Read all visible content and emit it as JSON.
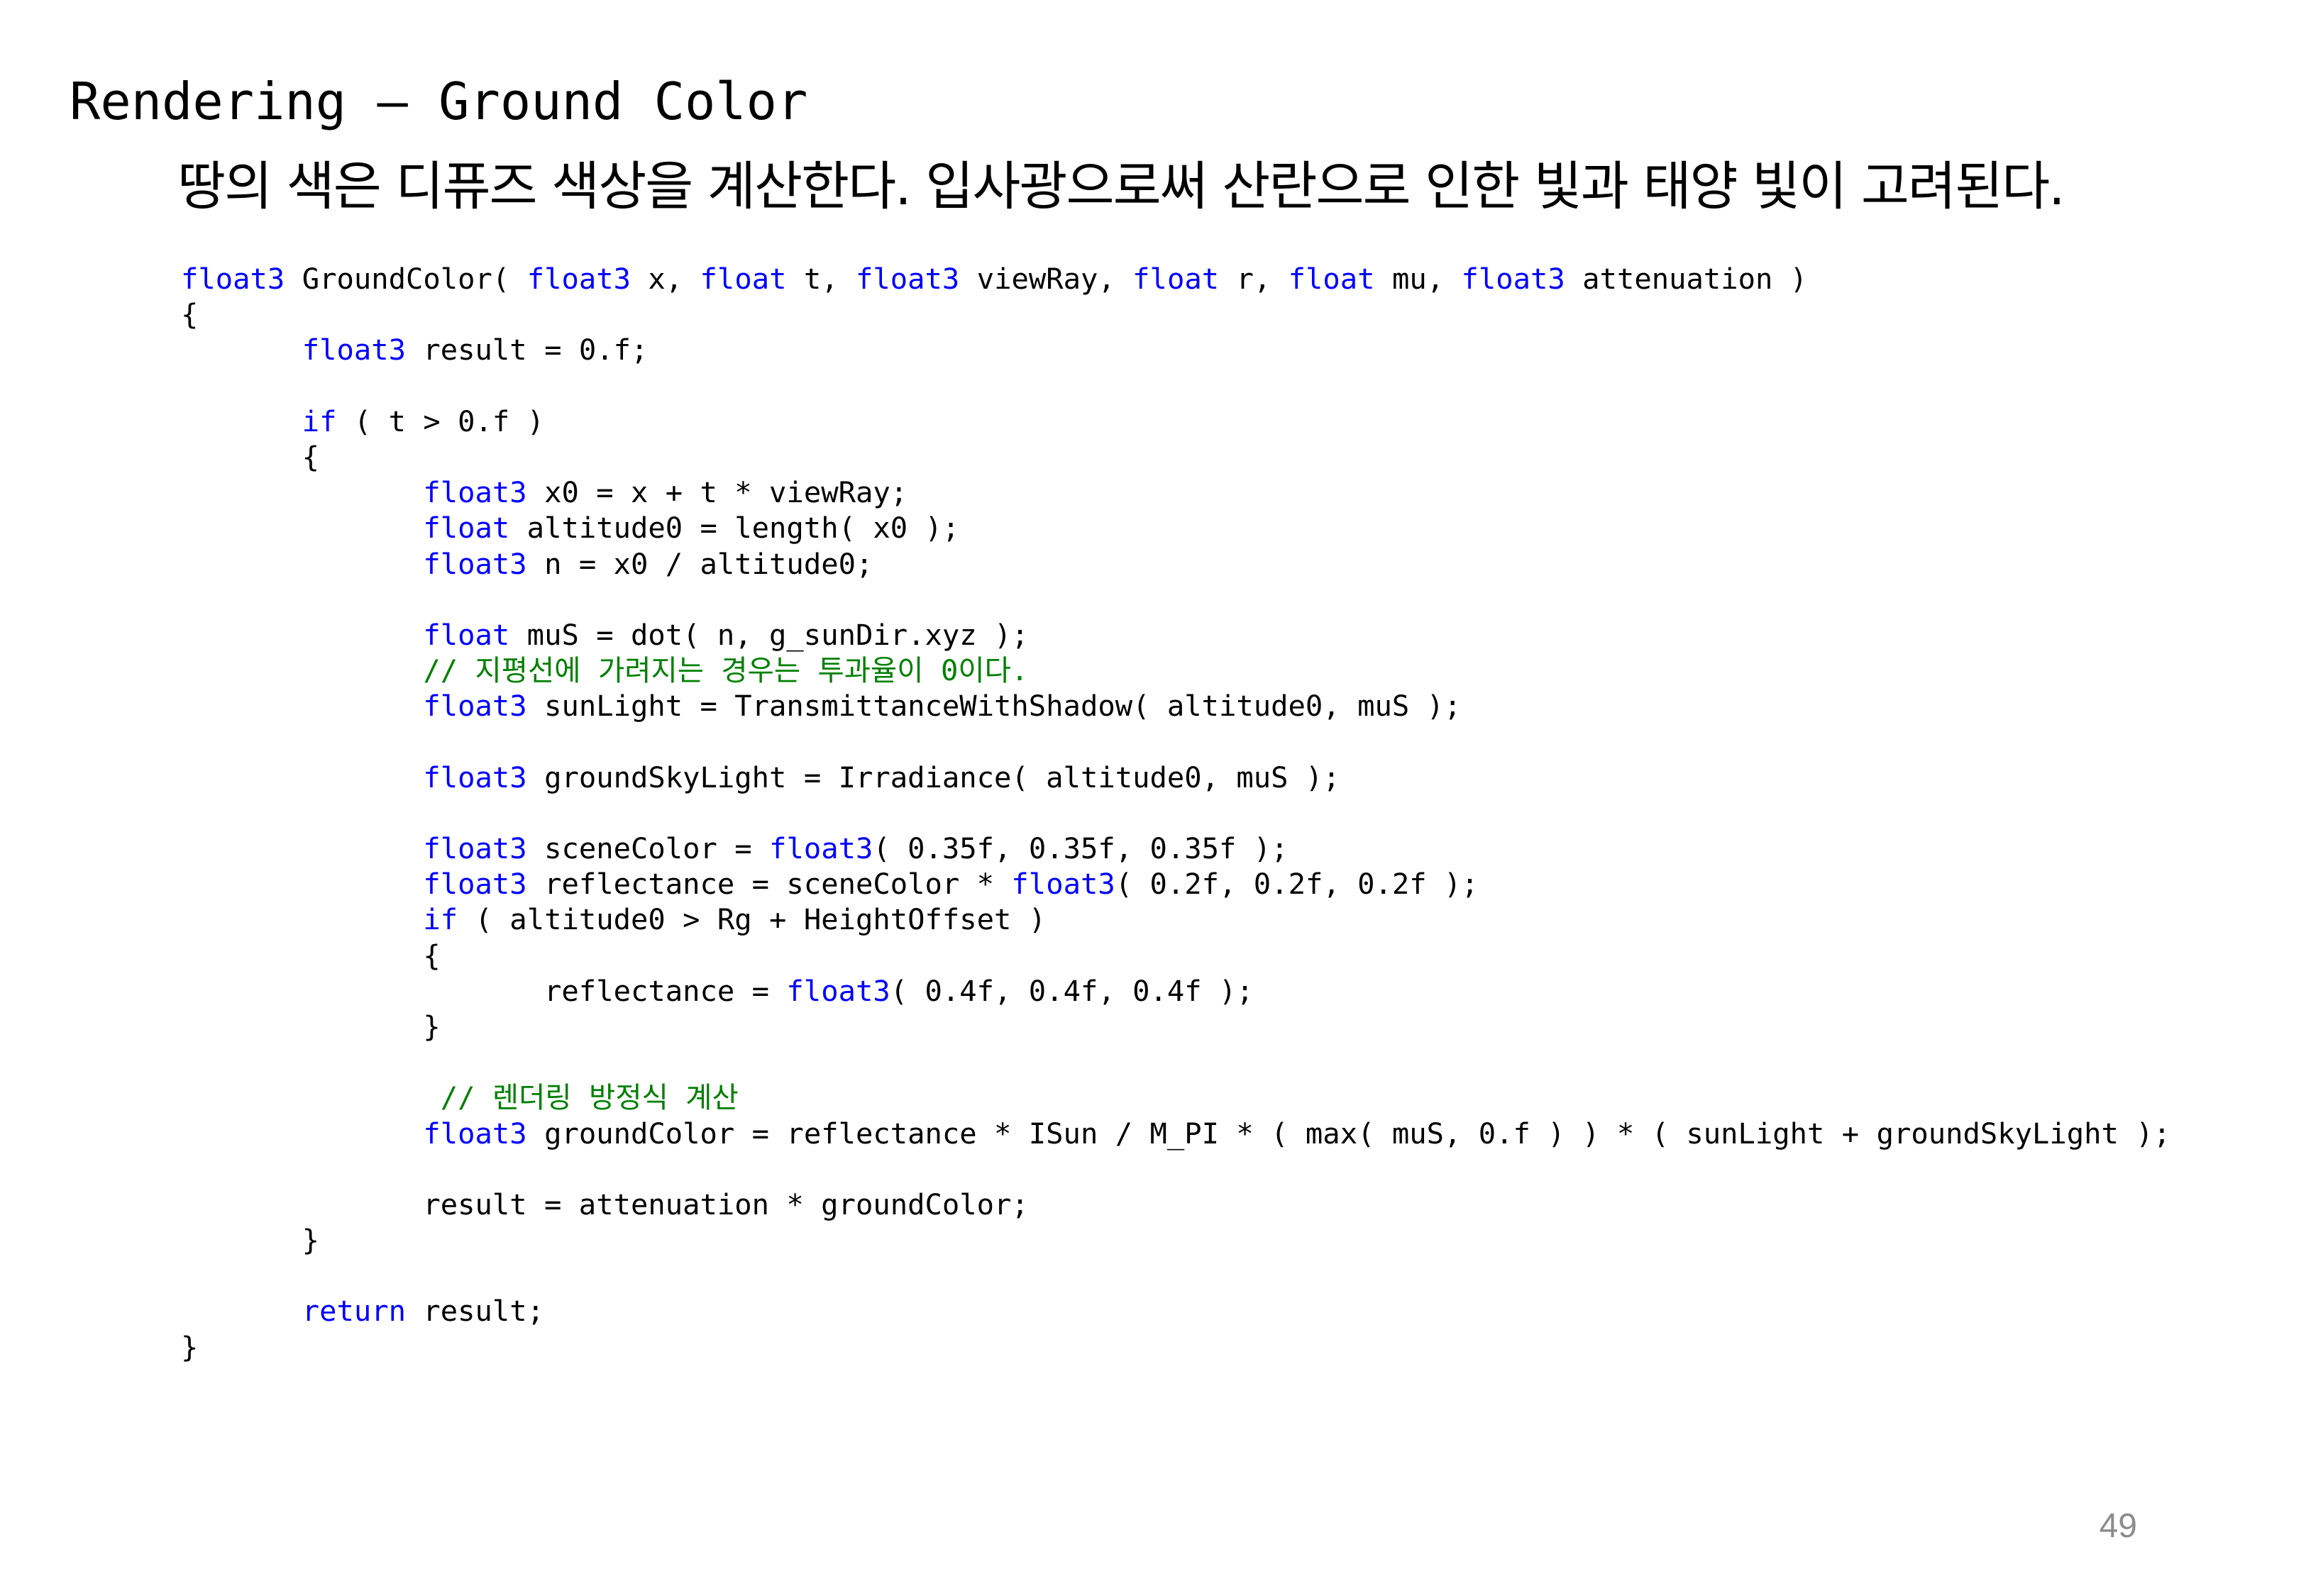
{
  "slide": {
    "title": "Rendering – Ground Color",
    "subtitle": "땅의 색은 디퓨즈 색상을 계산한다. 입사광으로써 산란으로 인한 빛과 태양 빛이 고려된다.",
    "page_number": "49"
  },
  "colors": {
    "keyword": "#0000ff",
    "comment": "#008000",
    "plain": "#000000",
    "page_number": "#8c8c8c"
  },
  "code": {
    "language": "hlsl",
    "lines": [
      [
        {
          "t": "kw",
          "v": "float3"
        },
        {
          "t": "pt",
          "v": " GroundColor( "
        },
        {
          "t": "kw",
          "v": "float3"
        },
        {
          "t": "pt",
          "v": " x, "
        },
        {
          "t": "kw",
          "v": "float"
        },
        {
          "t": "pt",
          "v": " t, "
        },
        {
          "t": "kw",
          "v": "float3"
        },
        {
          "t": "pt",
          "v": " viewRay, "
        },
        {
          "t": "kw",
          "v": "float"
        },
        {
          "t": "pt",
          "v": " r, "
        },
        {
          "t": "kw",
          "v": "float"
        },
        {
          "t": "pt",
          "v": " mu, "
        },
        {
          "t": "kw",
          "v": "float3"
        },
        {
          "t": "pt",
          "v": " attenuation )"
        }
      ],
      [
        {
          "t": "pt",
          "v": "{"
        }
      ],
      [
        {
          "t": "pt",
          "v": "\t"
        },
        {
          "t": "kw",
          "v": "float3"
        },
        {
          "t": "pt",
          "v": " result = 0.f;"
        }
      ],
      [],
      [
        {
          "t": "pt",
          "v": "\t"
        },
        {
          "t": "kw",
          "v": "if"
        },
        {
          "t": "pt",
          "v": " ( t > 0.f )"
        }
      ],
      [
        {
          "t": "pt",
          "v": "\t{"
        }
      ],
      [
        {
          "t": "pt",
          "v": "\t\t"
        },
        {
          "t": "kw",
          "v": "float3"
        },
        {
          "t": "pt",
          "v": " x0 = x + t * viewRay;"
        }
      ],
      [
        {
          "t": "pt",
          "v": "\t\t"
        },
        {
          "t": "kw",
          "v": "float"
        },
        {
          "t": "pt",
          "v": " altitude0 = length( x0 );"
        }
      ],
      [
        {
          "t": "pt",
          "v": "\t\t"
        },
        {
          "t": "kw",
          "v": "float3"
        },
        {
          "t": "pt",
          "v": " n = x0 / altitude0;"
        }
      ],
      [],
      [
        {
          "t": "pt",
          "v": "\t\t"
        },
        {
          "t": "kw",
          "v": "float"
        },
        {
          "t": "pt",
          "v": " muS = dot( n, g_sunDir.xyz );"
        }
      ],
      [
        {
          "t": "pt",
          "v": "\t\t"
        },
        {
          "t": "cm",
          "v": "// 지평선에 가려지는 경우는 투과율이 0이다."
        }
      ],
      [
        {
          "t": "pt",
          "v": "\t\t"
        },
        {
          "t": "kw",
          "v": "float3"
        },
        {
          "t": "pt",
          "v": " sunLight = TransmittanceWithShadow( altitude0, muS );"
        }
      ],
      [],
      [
        {
          "t": "pt",
          "v": "\t\t"
        },
        {
          "t": "kw",
          "v": "float3"
        },
        {
          "t": "pt",
          "v": " groundSkyLight = Irradiance( altitude0, muS );"
        }
      ],
      [],
      [
        {
          "t": "pt",
          "v": "\t\t"
        },
        {
          "t": "kw",
          "v": "float3"
        },
        {
          "t": "pt",
          "v": " sceneColor = "
        },
        {
          "t": "kw",
          "v": "float3"
        },
        {
          "t": "pt",
          "v": "( 0.35f, 0.35f, 0.35f );"
        }
      ],
      [
        {
          "t": "pt",
          "v": "\t\t"
        },
        {
          "t": "kw",
          "v": "float3"
        },
        {
          "t": "pt",
          "v": " reflectance = sceneColor * "
        },
        {
          "t": "kw",
          "v": "float3"
        },
        {
          "t": "pt",
          "v": "( 0.2f, 0.2f, 0.2f );"
        }
      ],
      [
        {
          "t": "pt",
          "v": "\t\t"
        },
        {
          "t": "kw",
          "v": "if"
        },
        {
          "t": "pt",
          "v": " ( altitude0 > Rg + HeightOffset )"
        }
      ],
      [
        {
          "t": "pt",
          "v": "\t\t{"
        }
      ],
      [
        {
          "t": "pt",
          "v": "\t\t\treflectance = "
        },
        {
          "t": "kw",
          "v": "float3"
        },
        {
          "t": "pt",
          "v": "( 0.4f, 0.4f, 0.4f );"
        }
      ],
      [
        {
          "t": "pt",
          "v": "\t\t}"
        }
      ],
      [],
      [
        {
          "t": "pt",
          "v": "\t\t "
        },
        {
          "t": "cm",
          "v": "// 렌더링 방정식 계산"
        }
      ],
      [
        {
          "t": "pt",
          "v": "\t\t"
        },
        {
          "t": "kw",
          "v": "float3"
        },
        {
          "t": "pt",
          "v": " groundColor = reflectance * ISun / M_PI * ( max( muS, 0.f ) ) * ( sunLight + groundSkyLight );"
        }
      ],
      [],
      [
        {
          "t": "pt",
          "v": "\t\tresult = attenuation * groundColor;"
        }
      ],
      [
        {
          "t": "pt",
          "v": "\t}"
        }
      ],
      [],
      [
        {
          "t": "pt",
          "v": "\t"
        },
        {
          "t": "kw",
          "v": "return"
        },
        {
          "t": "pt",
          "v": " result;"
        }
      ],
      [
        {
          "t": "pt",
          "v": "}"
        }
      ]
    ]
  }
}
